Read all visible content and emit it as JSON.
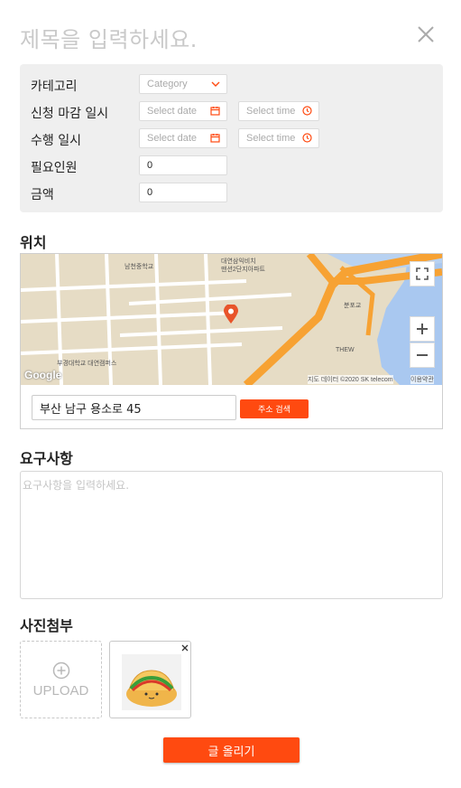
{
  "header": {
    "title_placeholder": "제목을 입력하세요.",
    "close_icon": "close-icon"
  },
  "info": {
    "category_label": "카테고리",
    "category_placeholder": "Category",
    "deadline_label": "신청 마감 일시",
    "deadline_date_placeholder": "Select date",
    "deadline_time_placeholder": "Select time",
    "perform_label": "수행 일시",
    "perform_date_placeholder": "Select date",
    "perform_time_placeholder": "Select time",
    "people_label": "필요인원",
    "people_value": "0",
    "amount_label": "금액",
    "amount_value": "0"
  },
  "location": {
    "section_label": "위치",
    "map": {
      "labels": {
        "school_top": "남천중학교",
        "apt": "대연삼익비치\n맨션2단지아파트",
        "univ": "부경대학교 대연캠퍼스",
        "bunpo": "분포교",
        "thew": "THEW",
        "attribution": "지도 데이터 ©2020 SK telecom",
        "terms": "이용약관",
        "google": "Google"
      }
    },
    "address_value": "부산 남구 용소로 45",
    "search_button": "주소 검색"
  },
  "requirements": {
    "section_label": "요구사항",
    "placeholder": "요구사항을 입력하세요."
  },
  "attachments": {
    "section_label": "사진첨부",
    "upload_label": "UPLOAD"
  },
  "submit": {
    "label": "글 올리기"
  },
  "colors": {
    "accent": "#ff4a10",
    "info_bg": "#efefef"
  }
}
